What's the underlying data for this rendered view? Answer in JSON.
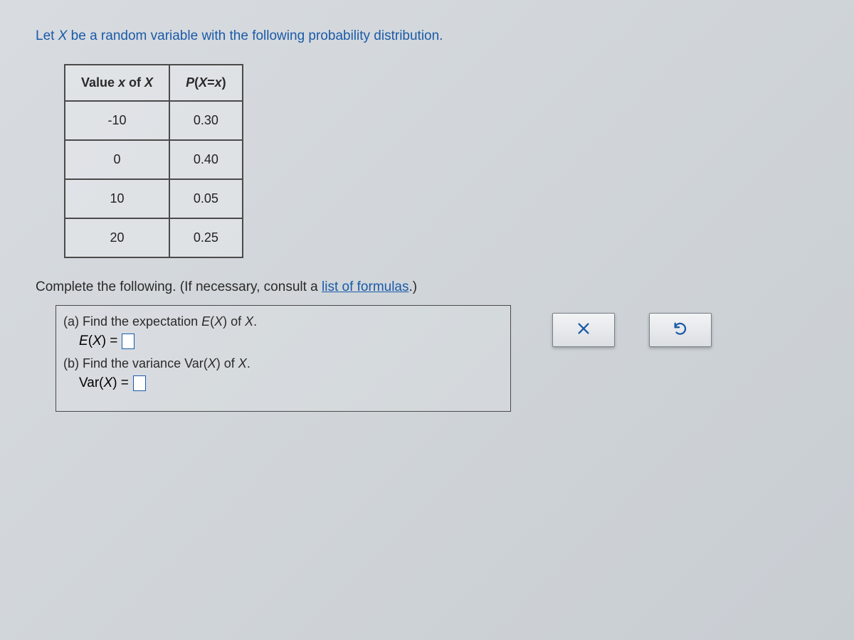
{
  "intro": {
    "prefix": "Let ",
    "var": "X",
    "suffix": " be a random variable with the following probability distribution."
  },
  "table": {
    "header1_prefix": "Value ",
    "header1_var": "x",
    "header1_suffix": " of ",
    "header1_bigvar": "X",
    "header2_fn": "P",
    "header2_open": "(",
    "header2_bigvar": "X",
    "header2_eq": "=",
    "header2_var": "x",
    "header2_close": ")",
    "rows": [
      {
        "x": "-10",
        "p": "0.30"
      },
      {
        "x": "0",
        "p": "0.40"
      },
      {
        "x": "10",
        "p": "0.05"
      },
      {
        "x": "20",
        "p": "0.25"
      }
    ]
  },
  "complete": {
    "prefix": "Complete the following. (If necessary, consult a ",
    "link": "list of formulas",
    "suffix": ".)"
  },
  "parts": {
    "a_label": "(a) Find the expectation ",
    "a_fn": "E",
    "a_paren_open": "(",
    "a_var": "X",
    "a_paren_close": ")",
    "a_of": " of ",
    "a_end": ".",
    "a_eq_fn": "E",
    "a_eq_open": "(",
    "a_eq_var": "X",
    "a_eq_close": ")",
    "a_eq_sign": " = ",
    "b_label": "(b) Find the variance Var",
    "b_paren_open": "(",
    "b_var": "X",
    "b_paren_close": ")",
    "b_of": " of ",
    "b_end": ".",
    "b_eq_fn": "Var",
    "b_eq_open": "(",
    "b_eq_var": "X",
    "b_eq_close": ")",
    "b_eq_sign": " = "
  }
}
